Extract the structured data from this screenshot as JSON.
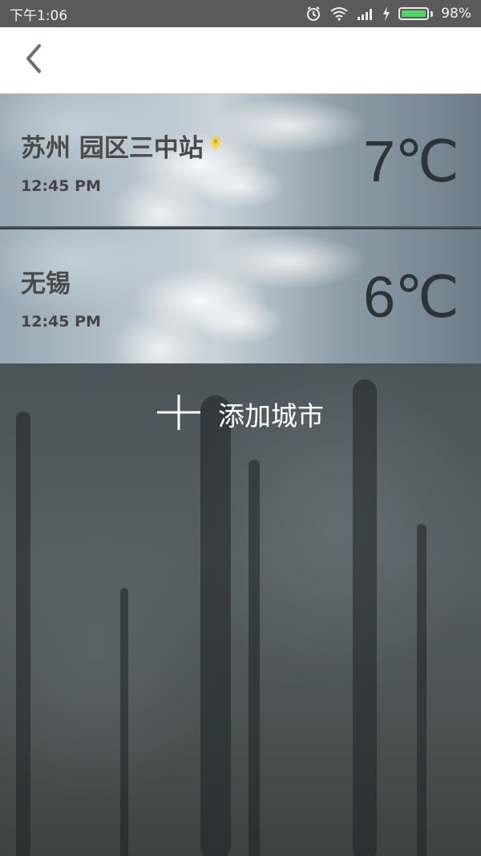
{
  "status_bar": {
    "time": "下午1:06",
    "battery_percent": "98%",
    "battery_level": 0.98
  },
  "app_bar": {
    "back_icon": "chevron-left-icon"
  },
  "cities": [
    {
      "name": "苏州 园区三中站",
      "time": "12:45 PM",
      "temperature": "7℃",
      "is_current_location": true
    },
    {
      "name": "无锡",
      "time": "12:45 PM",
      "temperature": "6℃",
      "is_current_location": false
    }
  ],
  "add_city": {
    "label": "添加城市",
    "icon": "plus-icon"
  },
  "colors": {
    "location_pin": "#f5d547",
    "battery_fill": "#4cd964",
    "text_light": "#ffffff"
  }
}
